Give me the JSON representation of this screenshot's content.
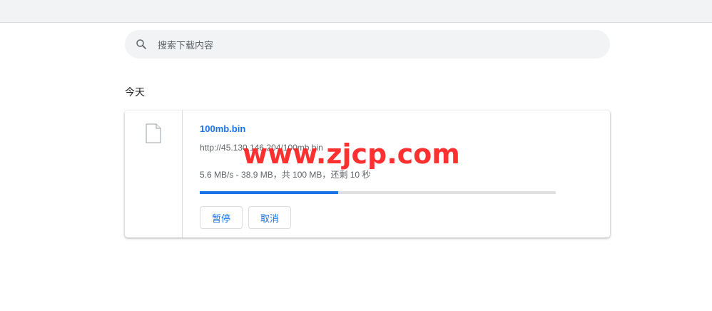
{
  "search": {
    "placeholder": "搜索下载内容",
    "value": ""
  },
  "section": {
    "title": "今天"
  },
  "download": {
    "file_name": "100mb.bin",
    "url": "http://45.130.146.204/100mb.bin",
    "status": "5.6 MB/s - 38.9 MB，共 100 MB，还剩 10 秒",
    "progress_percent": 38.9,
    "pause_label": "暂停",
    "cancel_label": "取消"
  },
  "watermark": {
    "text": "www.zjcp.com"
  },
  "colors": {
    "accent": "#1a73e8",
    "watermark": "#ff1a1a",
    "toolbar_bg": "#f1f3f4"
  }
}
